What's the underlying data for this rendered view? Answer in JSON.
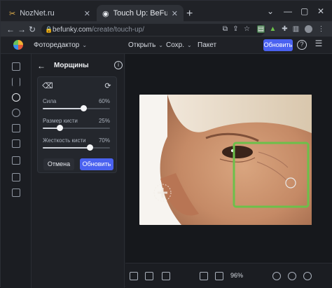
{
  "browser": {
    "tabs": [
      {
        "title": "NozNet.ru",
        "active": false
      },
      {
        "title": "Touch Up: BeFunky - Image Retou",
        "active": true
      }
    ],
    "address": {
      "domain": "befunky.com",
      "path": "/create/touch-up/"
    }
  },
  "app": {
    "menu_editor": "Фоторедактор",
    "menu_open": "Открыть",
    "menu_save": "Сохр.",
    "menu_batch": "Пакет",
    "update_button": "Обновить",
    "accent": "#4a62f0"
  },
  "panel": {
    "title": "Морщины",
    "sliders": [
      {
        "label": "Сила",
        "value": "60%",
        "level": 0.6
      },
      {
        "label": "Размер кисти",
        "value": "25%",
        "level": 0.25
      },
      {
        "label": "Жесткость кисти",
        "value": "70%",
        "level": 0.7
      }
    ],
    "cancel_label": "Отмена",
    "apply_label": "Обновить"
  },
  "canvas": {
    "zoom": "96%",
    "highlight_color": "#6cc04a"
  }
}
